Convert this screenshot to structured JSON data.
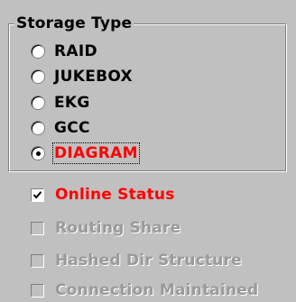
{
  "storage_type": {
    "title": "Storage Type",
    "options": [
      {
        "label": "RAID",
        "selected": false
      },
      {
        "label": "JUKEBOX",
        "selected": false
      },
      {
        "label": "EKG",
        "selected": false
      },
      {
        "label": "GCC",
        "selected": false
      },
      {
        "label": "DIAGRAM",
        "selected": true
      }
    ]
  },
  "checkboxes": [
    {
      "label": "Online Status",
      "checked": true,
      "enabled": true
    },
    {
      "label": "Routing Share",
      "checked": false,
      "enabled": false
    },
    {
      "label": "Hashed Dir Structure",
      "checked": false,
      "enabled": false
    },
    {
      "label": "Connection Maintained",
      "checked": false,
      "enabled": false
    }
  ],
  "colors": {
    "background": "#c0c0c0",
    "highlight_text": "#ff0000",
    "disabled_text": "#9a9a9a"
  }
}
